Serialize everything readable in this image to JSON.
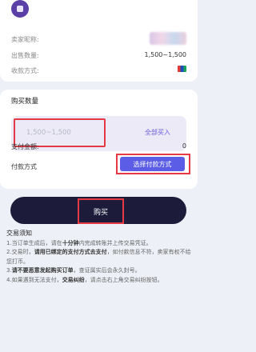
{
  "seller": {
    "nickname_label": "卖家昵称:",
    "qty_label": "出售数量:",
    "qty_value": "1,500~1,500",
    "pay_label": "收款方式:"
  },
  "buy": {
    "title": "购买数量",
    "placeholder": "1,500~1,500",
    "buy_all": "全部买入",
    "amount_label": "支付金额:",
    "amount_value": "0",
    "method_label": "付款方式",
    "choose_method": "选择付款方式"
  },
  "action": {
    "buy_label": "购买"
  },
  "notes": {
    "title": "交易须知",
    "line1_a": "1.当订单生成后，请在",
    "line1_b": "十分钟",
    "line1_c": "内完成转账并上传交易凭证。",
    "line2_a": "2.交易时，",
    "line2_b": "请用已绑定的支付方式去支付",
    "line2_c": "，如付款信息不符，卖家有权不给您打币。",
    "line3_a": "3.",
    "line3_b": "请不要恶意发起购买订单",
    "line3_c": "，查证属实后会永久封号。",
    "line4_a": "4.如果遇到无法支付，",
    "line4_b": "交易纠纷",
    "line4_c": "，请点击右上角交易纠纷按钮。"
  },
  "colors": {
    "accent": "#5b5de6",
    "highlight_border": "#e53a46",
    "buy_bar": "#1d1b3a"
  }
}
